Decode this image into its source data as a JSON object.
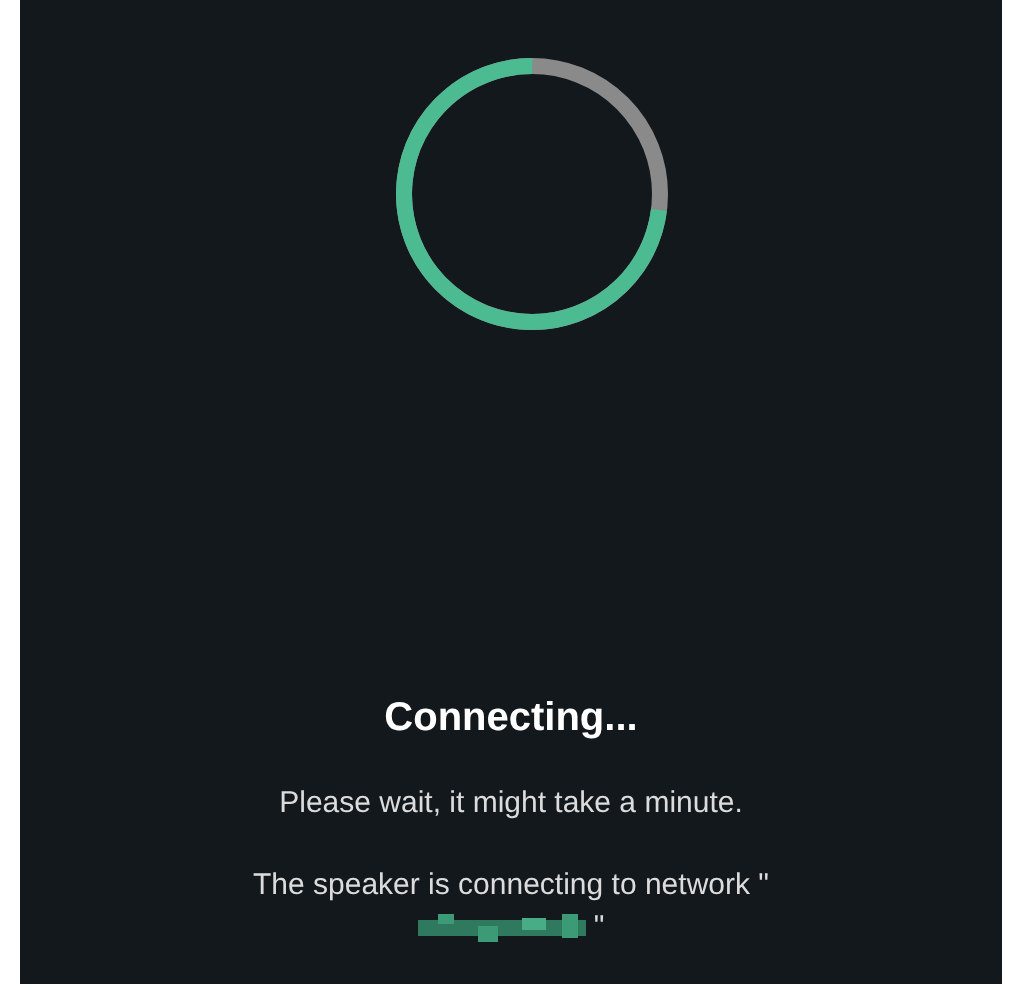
{
  "progress": {
    "level": 0.73
  },
  "title": "Connecting...",
  "subtitle": "Please wait, it might take a minute.",
  "message": {
    "prefix": "The speaker is connecting to network \"",
    "suffix": "\""
  }
}
